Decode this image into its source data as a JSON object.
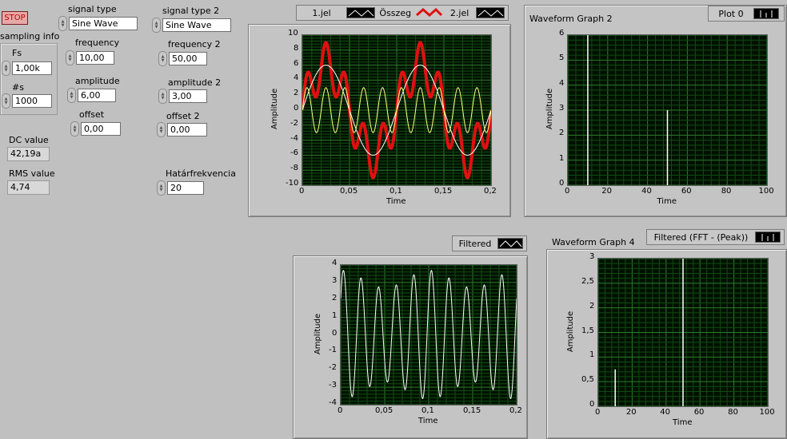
{
  "controls": {
    "stop_label": "STOP",
    "sampling_info_label": "sampling info",
    "fs_label": "Fs",
    "fs_value": "1,00k",
    "ns_label": "#s",
    "ns_value": "1000",
    "dc_label": "DC value",
    "dc_value": "42,19a",
    "rms_label": "RMS value",
    "rms_value": "4,74",
    "signal_type_label": "signal type",
    "signal_type_value": "Sine Wave",
    "frequency_label": "frequency",
    "frequency_value": "10,00",
    "amplitude_label": "amplitude",
    "amplitude_value": "6,00",
    "offset_label": "offset",
    "offset_value": "0,00",
    "signal_type2_label": "signal type 2",
    "signal_type2_value": "Sine Wave",
    "frequency2_label": "frequency 2",
    "frequency2_value": "50,00",
    "amplitude2_label": "amplitude 2",
    "amplitude2_value": "3,00",
    "offset2_label": "offset 2",
    "offset2_value": "0,00",
    "cutoff_label": "Határfrekvencia",
    "cutoff_value": "20"
  },
  "graphs": {
    "g1_legend": [
      "1.jel",
      "Összeg",
      "2.jel"
    ],
    "g2_title": "Waveform Graph 2",
    "g2_legend": "Plot 0",
    "g3_legend": "Filtered",
    "g4_title": "Waveform Graph 4",
    "g4_legend": "Filtered (FFT - (Peak))"
  },
  "chart_data": [
    {
      "type": "line",
      "xlabel": "Time",
      "ylabel": "Amplitude",
      "xlim": [
        0,
        0.2
      ],
      "ylim": [
        -10,
        10
      ],
      "x_ticks": [
        "0",
        "0,05",
        "0,1",
        "0,15",
        "0,2"
      ],
      "y_ticks": [
        "10",
        "8",
        "6",
        "4",
        "2",
        "0",
        "-2",
        "-4",
        "-6",
        "-8",
        "-10"
      ],
      "grid": true,
      "series": [
        {
          "name": "1.jel",
          "kind": "sine",
          "frequency": 10,
          "amplitude": 6,
          "offset": 0,
          "color": "#ffffff"
        },
        {
          "name": "2.jel",
          "kind": "sine",
          "frequency": 50,
          "amplitude": 3,
          "offset": 0,
          "color": "#ffff80"
        },
        {
          "name": "Összeg",
          "kind": "sum",
          "color": "#e01010"
        }
      ]
    },
    {
      "type": "bar",
      "xlabel": "Time",
      "ylabel": "Amplitude",
      "xlim": [
        0,
        100
      ],
      "ylim": [
        0,
        6
      ],
      "x_ticks": [
        "0",
        "20",
        "40",
        "60",
        "80",
        "100"
      ],
      "y_ticks": [
        "6",
        "5",
        "4",
        "3",
        "2",
        "1",
        "0"
      ],
      "grid": true,
      "series": [
        {
          "name": "Plot 0",
          "x": [
            10,
            50
          ],
          "values": [
            6,
            3
          ],
          "color": "#ffffff"
        }
      ]
    },
    {
      "type": "line",
      "xlabel": "Time",
      "ylabel": "Amplitude",
      "xlim": [
        0,
        0.2
      ],
      "ylim": [
        -4,
        4
      ],
      "x_ticks": [
        "0",
        "0,05",
        "0,1",
        "0,15",
        "0,2"
      ],
      "y_ticks": [
        "4",
        "3",
        "2",
        "1",
        "0",
        "-1",
        "-2",
        "-3",
        "-4"
      ],
      "grid": true,
      "series": [
        {
          "name": "Filtered",
          "kind": "sine_mod",
          "frequency": 50,
          "amplitude": 3.2,
          "mod_amplitude": 0.5,
          "mod_frequency": 10,
          "color": "#ffffff"
        }
      ]
    },
    {
      "type": "bar",
      "xlabel": "Time",
      "ylabel": "Amplitude",
      "xlim": [
        0,
        100
      ],
      "ylim": [
        0,
        3
      ],
      "x_ticks": [
        "0",
        "20",
        "40",
        "60",
        "80",
        "100"
      ],
      "y_ticks": [
        "3",
        "2,5",
        "2",
        "1,5",
        "1",
        "0,5",
        "0"
      ],
      "grid": true,
      "series": [
        {
          "name": "Filtered (FFT - (Peak))",
          "x": [
            10,
            50
          ],
          "values": [
            0.75,
            3
          ],
          "color": "#ffffff"
        }
      ]
    }
  ]
}
